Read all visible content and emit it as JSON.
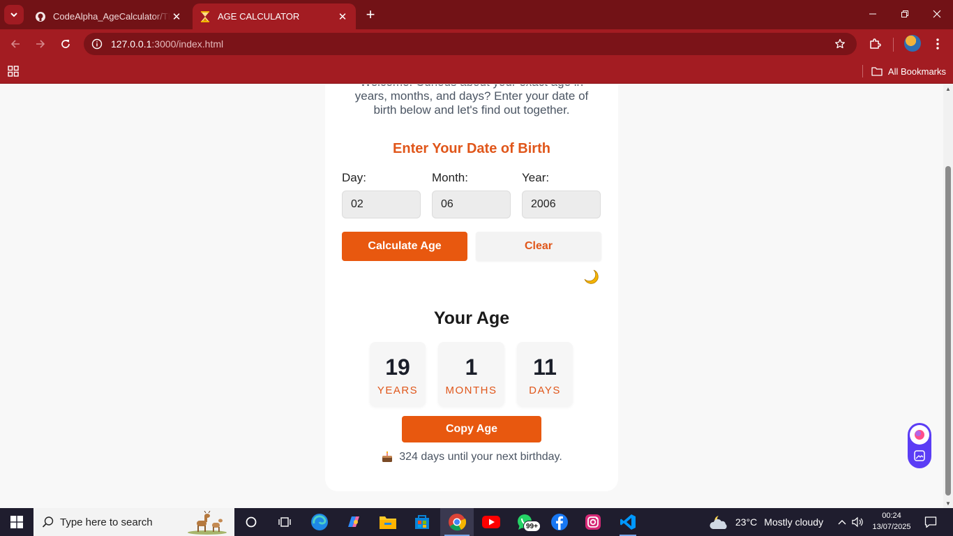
{
  "browser": {
    "tabs": [
      {
        "title": "CodeAlpha_AgeCalculator/TEST",
        "active": false
      },
      {
        "title": "AGE CALCULATOR",
        "active": true
      }
    ],
    "address": {
      "host": "127.0.0.1",
      "path": ":3000/index.html"
    },
    "bookmarks_label": "All Bookmarks"
  },
  "page": {
    "welcome": "Welcome! Curious about your exact age in years, months, and days? Enter your date of birth below and let's find out together.",
    "form_heading": "Enter Your Date of Birth",
    "fields": {
      "day": {
        "label": "Day:",
        "value": "02"
      },
      "month": {
        "label": "Month:",
        "value": "06"
      },
      "year": {
        "label": "Year:",
        "value": "2006"
      }
    },
    "calculate_label": "Calculate Age",
    "clear_label": "Clear",
    "result_heading": "Your Age",
    "result": {
      "years": {
        "value": "19",
        "unit": "YEARS"
      },
      "months": {
        "value": "1",
        "unit": "MONTHS"
      },
      "days": {
        "value": "11",
        "unit": "DAYS"
      }
    },
    "copy_label": "Copy Age",
    "birthday_text": "324 days until your next birthday."
  },
  "taskbar": {
    "search_placeholder": "Type here to search",
    "whatsapp_badge": "99+",
    "weather": {
      "temp": "23°C",
      "condition": "Mostly cloudy"
    },
    "time": "00:24",
    "date": "13/07/2025"
  },
  "colors": {
    "browser_frame": "#721216",
    "browser_toolbar": "#a31c22",
    "accent": "#e8580f",
    "accent_text": "#e0561a"
  }
}
